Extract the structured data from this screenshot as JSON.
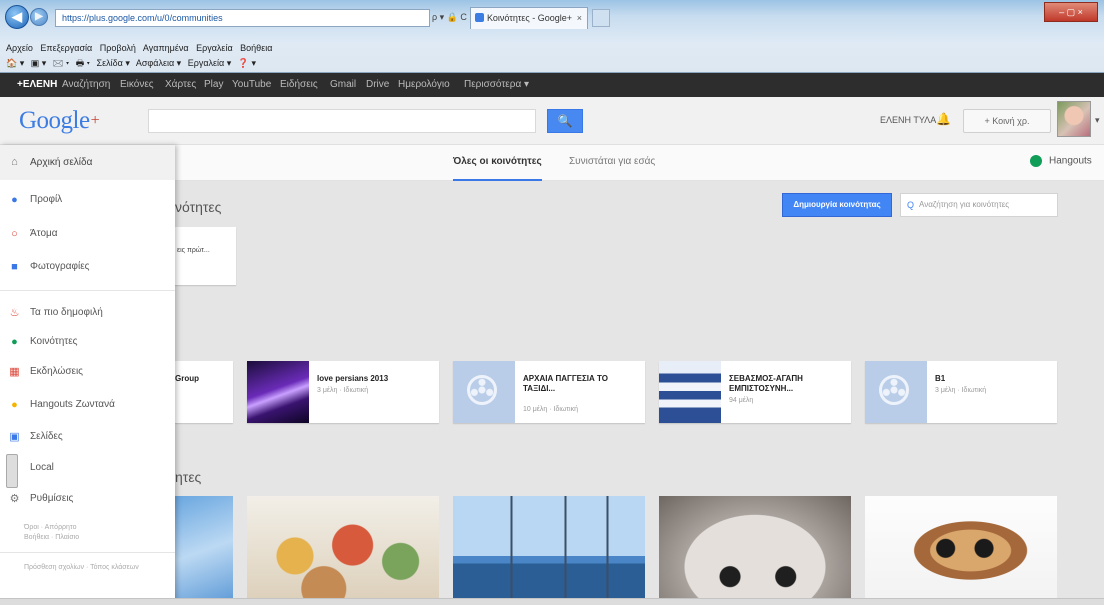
{
  "browser": {
    "address": "https://plus.google.com/u/0/communities",
    "address_controls": "ρ ▾ 🔒 C",
    "tab_title": "Κοινότητες - Google+",
    "tab_close": "×",
    "window_controls": "– ▢ ×",
    "back": "◀",
    "forward": "▶",
    "menu": [
      "Αρχείο",
      "Επεξεργασία",
      "Προβολή",
      "Αγαπημένα",
      "Εργαλεία",
      "Βοήθεια"
    ],
    "command_bar": [
      "🏠 ▾",
      "▣ ▾",
      "🖂 ▾",
      "🖶 ▾",
      "Σελίδα ▾",
      "Ασφάλεια ▾",
      "Εργαλεία ▾",
      "❓ ▾"
    ]
  },
  "gbar": {
    "items": [
      "+ΕΛΕΝΗ",
      "Αναζήτηση",
      "Εικόνες",
      "Χάρτες",
      "Play",
      "YouTube",
      "Ειδήσεις",
      "Gmail",
      "Drive",
      "Ημερολόγιο",
      "Περισσότερα ▾"
    ]
  },
  "header": {
    "logo": "Google",
    "logo_plus": "+",
    "search_placeholder": "",
    "search_icon": "🔍",
    "user_name": "ΕΛΕΝΗ ΤΥΛΑ",
    "bell_icon": "🔔",
    "share_label": "+ Κοινή χρ.",
    "avatar_caret": "▾"
  },
  "subnav": {
    "tabs": [
      "Όλες οι κοινότητες",
      "Συνιστάται για εσάς"
    ],
    "hangouts": "Hangouts"
  },
  "sidebar": {
    "home": "Αρχική σελίδα",
    "items": [
      {
        "label": "Προφίλ",
        "icon": "profile-icon",
        "glyph": "●",
        "color": "#3b78e7"
      },
      {
        "label": "Άτομα",
        "icon": "people-icon",
        "glyph": "○",
        "color": "#db4437"
      },
      {
        "label": "Φωτογραφίες",
        "icon": "photos-icon",
        "glyph": "■",
        "color": "#3b78e7"
      },
      {
        "label": "Τα πιο δημοφιλή",
        "icon": "whats-hot-icon",
        "glyph": "♨",
        "color": "#db4437"
      },
      {
        "label": "Κοινότητες",
        "icon": "communities-icon",
        "glyph": "●",
        "color": "#0f9d58"
      },
      {
        "label": "Εκδηλώσεις",
        "icon": "events-icon",
        "glyph": "▦",
        "color": "#db4437"
      },
      {
        "label": "Hangouts Ζωντανά",
        "icon": "hangouts-live-icon",
        "glyph": "●",
        "color": "#f4b400"
      },
      {
        "label": "Σελίδες",
        "icon": "pages-icon",
        "glyph": "▣",
        "color": "#3b78e7"
      },
      {
        "label": "Local",
        "icon": "local-icon",
        "glyph": "📍",
        "color": "#db4437"
      },
      {
        "label": "Ρυθμίσεις",
        "icon": "settings-icon",
        "glyph": "⚙",
        "color": "#777777"
      }
    ],
    "footer": [
      "Όροι · Απόρρητο",
      "Βοήθεια · Πλαίσιο",
      "Πρόσθεση σχολίων · Τόπος κλάσεων"
    ]
  },
  "content": {
    "section1_title": "νότητες",
    "create_button": "Δημιουργία κοινότητας",
    "community_search": "Αναζήτηση για κοινότητες",
    "mini_card_text": "εις πρώτ...",
    "section3_title": "ητες",
    "communities": [
      {
        "title": "Group",
        "meta": ""
      },
      {
        "title": "love persians 2013",
        "meta": "3 μέλη · Ιδιωτική"
      },
      {
        "title": "ΑΡΧΑΙΑ ΠΑΓΓΕΣΙΑ ΤΟ ΤΑΞΙΔΙ...",
        "meta": "10 μέλη · Ιδιωτική"
      },
      {
        "title": "ΣΕΒΑΣΜΟΣ-ΑΓΑΠΗ ΕΜΠΙΣΤΟΣΥΝΗ...",
        "meta": "94 μέλη"
      },
      {
        "title": "B1",
        "meta": "3 μέλη · Ιδιωτική"
      }
    ]
  },
  "colors": {
    "accent": "#4285f4",
    "gbar": "#2d2d2d",
    "hangouts_green": "#0f9d58"
  }
}
